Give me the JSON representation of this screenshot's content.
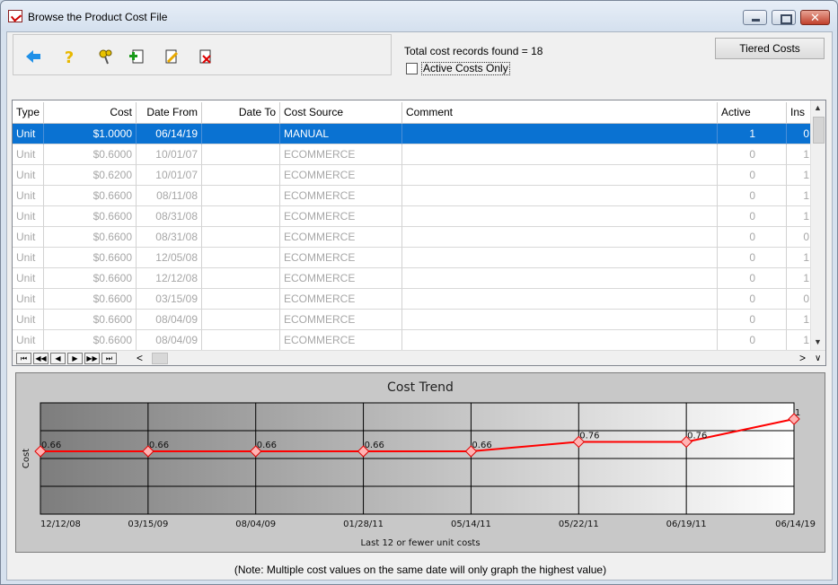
{
  "window": {
    "title": "Browse the Product Cost File",
    "close_glyph": "✕"
  },
  "toolbar": {
    "icons": [
      "back-arrow-icon",
      "help-question-icon",
      "search-key-icon",
      "add-record-icon",
      "edit-record-icon",
      "delete-record-icon"
    ]
  },
  "summary": {
    "records_text": "Total cost records found = 18",
    "active_only_label": "Active Costs Only",
    "active_only_checked": false
  },
  "tiered_button": "Tiered Costs",
  "grid": {
    "headers": [
      "Type",
      "Cost",
      "Date From",
      "Date To",
      "Cost Source",
      "Comment",
      "Active",
      "Ins"
    ],
    "rows": [
      {
        "type": "Unit",
        "cost": "$1.0000",
        "date_from": "06/14/19",
        "date_to": "",
        "source": "MANUAL",
        "comment": "",
        "active": "1",
        "ins": "0",
        "selected": true,
        "active_check": true
      },
      {
        "type": "Unit",
        "cost": "$0.6000",
        "date_from": "10/01/07",
        "date_to": "",
        "source": "ECOMMERCE",
        "comment": "",
        "active": "0",
        "ins": "1"
      },
      {
        "type": "Unit",
        "cost": "$0.6200",
        "date_from": "10/01/07",
        "date_to": "",
        "source": "ECOMMERCE",
        "comment": "",
        "active": "0",
        "ins": "1"
      },
      {
        "type": "Unit",
        "cost": "$0.6600",
        "date_from": "08/11/08",
        "date_to": "",
        "source": "ECOMMERCE",
        "comment": "",
        "active": "0",
        "ins": "1"
      },
      {
        "type": "Unit",
        "cost": "$0.6600",
        "date_from": "08/31/08",
        "date_to": "",
        "source": "ECOMMERCE",
        "comment": "",
        "active": "0",
        "ins": "1"
      },
      {
        "type": "Unit",
        "cost": "$0.6600",
        "date_from": "08/31/08",
        "date_to": "",
        "source": "ECOMMERCE",
        "comment": "",
        "active": "0",
        "ins": "0"
      },
      {
        "type": "Unit",
        "cost": "$0.6600",
        "date_from": "12/05/08",
        "date_to": "",
        "source": "ECOMMERCE",
        "comment": "",
        "active": "0",
        "ins": "1"
      },
      {
        "type": "Unit",
        "cost": "$0.6600",
        "date_from": "12/12/08",
        "date_to": "",
        "source": "ECOMMERCE",
        "comment": "",
        "active": "0",
        "ins": "1"
      },
      {
        "type": "Unit",
        "cost": "$0.6600",
        "date_from": "03/15/09",
        "date_to": "",
        "source": "ECOMMERCE",
        "comment": "",
        "active": "0",
        "ins": "0"
      },
      {
        "type": "Unit",
        "cost": "$0.6600",
        "date_from": "08/04/09",
        "date_to": "",
        "source": "ECOMMERCE",
        "comment": "",
        "active": "0",
        "ins": "1"
      },
      {
        "type": "Unit",
        "cost": "$0.6600",
        "date_from": "08/04/09",
        "date_to": "",
        "source": "ECOMMERCE",
        "comment": "",
        "active": "0",
        "ins": "1"
      }
    ],
    "nav_buttons": [
      "⏮",
      "◀◀",
      "◀",
      "▶",
      "▶▶",
      "⏭"
    ],
    "hscroll_left": "<",
    "hscroll_right": ">"
  },
  "chart_data": {
    "type": "line",
    "title": "Cost Trend",
    "ylabel": "Cost",
    "xlabel": "Last 12 or fewer unit costs",
    "x_tick_labels": [
      "12/12/08",
      "03/15/09",
      "08/04/09",
      "01/28/11",
      "05/14/11",
      "05/22/11",
      "06/19/11",
      "06/14/19"
    ],
    "values": [
      0.66,
      0.66,
      0.66,
      0.66,
      0.66,
      0.76,
      0.76,
      1.0
    ],
    "data_labels": [
      "0.66",
      "0.66",
      "0.66",
      "0.66",
      "0.66",
      "0.76",
      "0.76",
      "1"
    ],
    "ylim": [
      0,
      1.0
    ],
    "grid": true,
    "line_color": "#ff0000",
    "background_gradient": [
      "#7d7d7d",
      "#ffffff"
    ]
  },
  "note": "(Note:  Multiple cost values on the same date will only graph the highest value)"
}
